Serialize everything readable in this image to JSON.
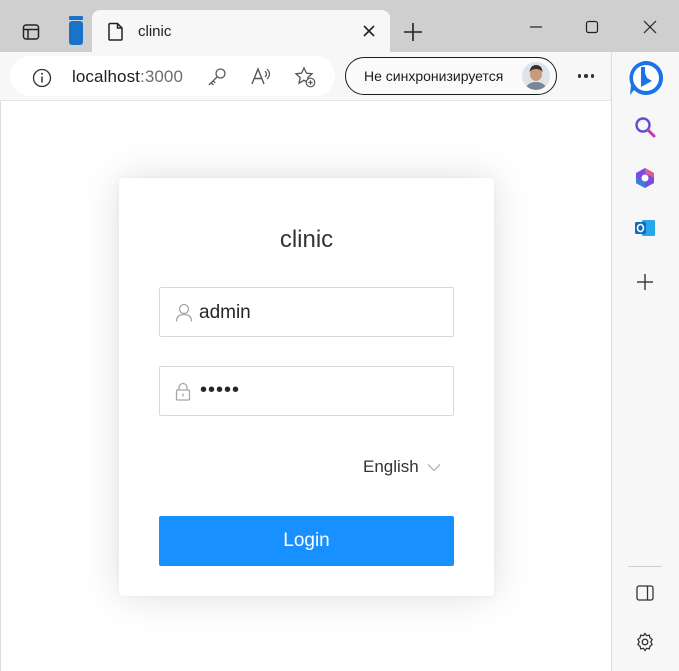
{
  "browser": {
    "tab": {
      "title": "clinic"
    },
    "address": {
      "host": "localhost",
      "port": ":3000"
    },
    "profile": {
      "sync_label": "Не синхронизируется"
    }
  },
  "login": {
    "title": "clinic",
    "username": "admin",
    "password_mask": "•••••",
    "language": "English",
    "submit_label": "Login"
  },
  "colors": {
    "primary": "#1890ff",
    "tabstrip": "#cfcfcf",
    "toolbar": "#f7f7f7"
  },
  "icons": [
    "tab-actions-icon",
    "vertical-tabs-icon",
    "page-icon",
    "close-icon",
    "plus-icon",
    "minimize-icon",
    "maximize-icon",
    "window-close-icon",
    "info-icon",
    "key-icon",
    "read-aloud-icon",
    "favorite-add-icon",
    "more-icon",
    "bing-icon",
    "search-icon",
    "office-icon",
    "outlook-icon",
    "add-icon",
    "sidebar-toggle-icon",
    "settings-icon",
    "user-icon",
    "lock-icon",
    "chevron-down-icon"
  ]
}
